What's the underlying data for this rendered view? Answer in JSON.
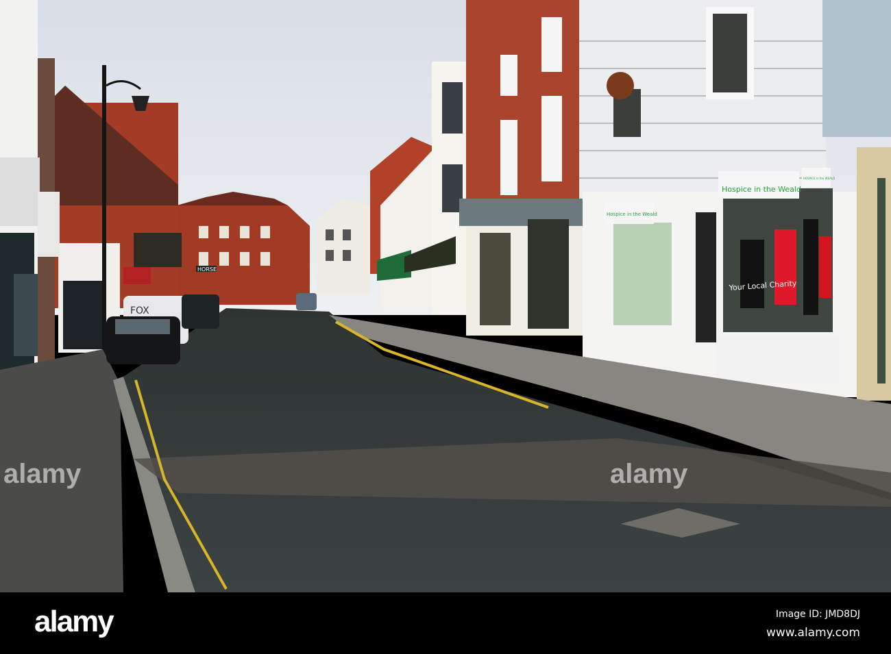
{
  "photo": {
    "shop_sign_large": "Hospice in the Weald",
    "shop_sign_small": "Hospice in the Weald",
    "window_text": "Your Local Charity",
    "shop_logo": "HOSPICE in the WEALD",
    "van_text": "FOX",
    "pub_sign": "HORSE",
    "watermarks": [
      "alamy",
      "alamy"
    ]
  },
  "footer": {
    "logo": "alamy",
    "image_id": "Image ID: JMD8DJ",
    "website": "www.alamy.com"
  },
  "colors": {
    "sky": "#e4e8ee",
    "brick": "#a2402a",
    "road": "#3a4040",
    "sign_green": "#1ea534"
  }
}
